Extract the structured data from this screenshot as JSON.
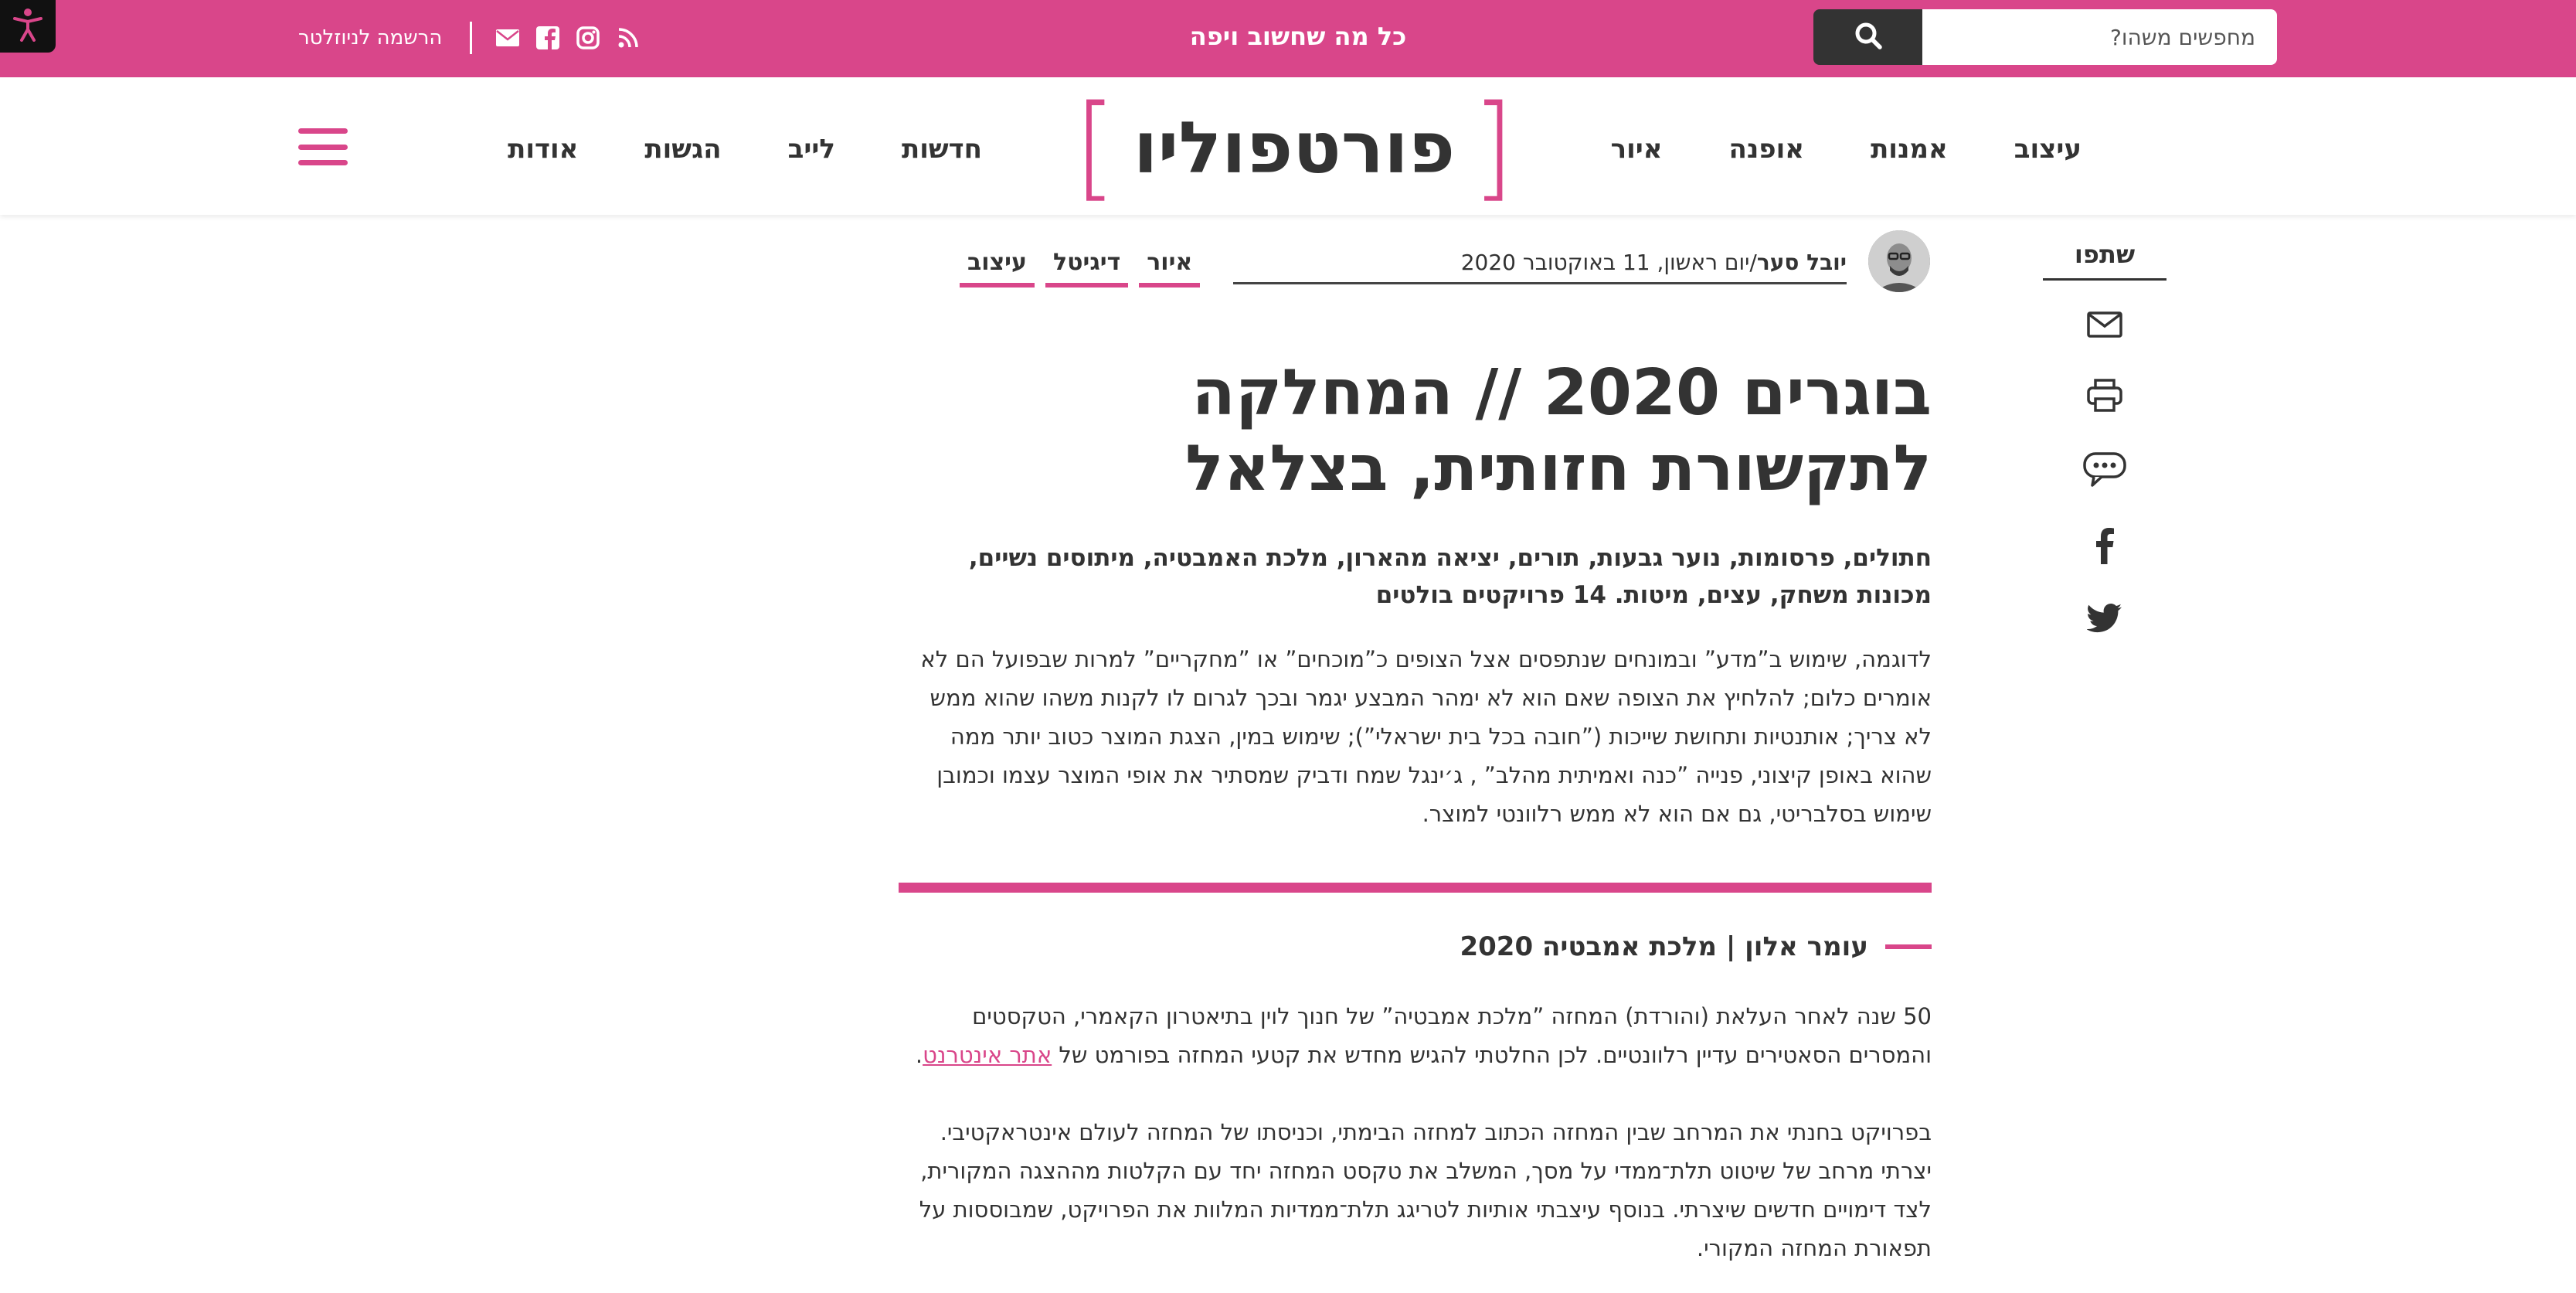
{
  "topbar": {
    "tagline": "כל מה שחשוב ויפה",
    "newsletter": "הרשמה לניוזלטר",
    "search_placeholder": "מחפשים משהו?",
    "icons": [
      "rss-icon",
      "instagram-icon",
      "facebook-icon",
      "mail-icon",
      "search-icon",
      "accessibility-icon"
    ]
  },
  "logo": {
    "text": "פורטפוליו"
  },
  "nav": {
    "right": [
      "עיצוב",
      "אמנות",
      "אופנה",
      "איור"
    ],
    "left": [
      "חדשות",
      "לייב",
      "הגשות",
      "אודות"
    ]
  },
  "share": {
    "title": "שתפו",
    "icons": [
      "mail-icon",
      "print-icon",
      "comment-icon",
      "facebook-icon",
      "twitter-icon"
    ]
  },
  "meta": {
    "author": "יובל סער",
    "separator": "/",
    "date": "יום ראשון, 11 באוקטובר 2020",
    "tags": [
      "עיצוב",
      "דיגיטל",
      "איור"
    ]
  },
  "article": {
    "title": "בוגרים 2020 // המחלקה לתקשורת חזותית, בצלאל",
    "subtitle": "חתולים, פרסומות, נוער גבעות, תורים, יציאה מהארון, מלכת האמבטיה, מיתוסים נשיים, מכונות משחק, עצים, מיטות. 14 פרויקטים בולטים",
    "intro": "לדוגמה, שימוש ב”מדע” ובמונחים שנתפסים אצל הצופים כ”מוכחים” או ”מחקריים” למרות שבפועל הם לא אומרים כלום; להלחיץ את הצופה שאם הוא לא ימהר המבצע יגמר ובכך לגרום לו לקנות משהו שהוא ממש לא צריך; אותנטיות ותחושת שייכות (”חובה בכל בית ישראלי”); שימוש במין, הצגת המוצר כטוב יותר ממה שהוא באופן קיצוני, פנייה ”כנה ואמיתית מהלב” , ג׳ינגל שמח ודביק שמסתיר את אופי המוצר עצמו וכמובן שימוש בסלבריטי, גם אם הוא לא ממש רלוונטי למוצר.",
    "section_title": "עומר אלון | מלכת אמבטיה 2020",
    "para1_text": "50 שנה לאחר העלאת (והורדת) המחזה ”מלכת אמבטיה” של חנוך לוין בתיאטרון הקאמרי, הטקסטים והמסרים הסאטירים עדיין רלוונטיים. לכן החלטתי להגיש מחדש את קטעי המחזה בפורמט של",
    "para1_link": "אתר אינטרנט",
    "para1_end": ".",
    "para2": "בפרויקט בחנתי את המרחב שבין המחזה הכתוב למחזה הבימתי, וכניסתו של המחזה לעולם אינטראקטיבי. יצרתי מרחב של שיטוט תלת־ממדי על מסך, המשלב את טקסט המחזה יחד עם הקלטות מההצגה המקורית, לצד דימויים חדשים שיצרתי. בנוסף עיצבתי אותיות לטריגג תלת־ממדיות המלוות את הפרויקט, שמבוססות על תפאורת המחזה המקורי."
  },
  "colors": {
    "accent": "#d9468a",
    "text": "#333333",
    "search_button": "#333333",
    "a11y_button": "#111111"
  }
}
